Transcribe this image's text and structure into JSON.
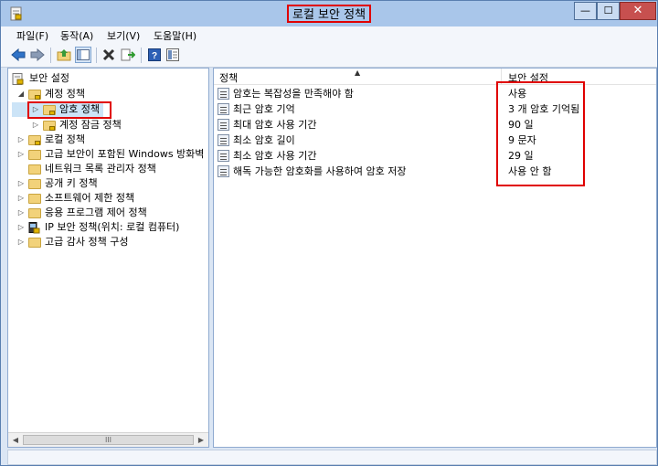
{
  "window": {
    "title": "로컬 보안 정책",
    "minimize_glyph": "—",
    "maximize_glyph": "☐",
    "close_glyph": "✕"
  },
  "menu": [
    "파일(F)",
    "동작(A)",
    "보기(V)",
    "도움말(H)"
  ],
  "toolbar_icons": [
    "back-arrow-icon",
    "forward-arrow-icon",
    "up-folder-icon",
    "show-hide-tree-icon",
    "delete-icon",
    "export-list-icon",
    "help-icon",
    "properties-icon"
  ],
  "tree": {
    "root": "보안 설정",
    "account_policies": "계정 정책",
    "password_policy": "암호 정책",
    "lockout_policy": "계정 잠금 정책",
    "local_policies": "로컬 정책",
    "firewall": "고급 보안이 포함된 Windows 방화벽",
    "network_list": "네트워크 목록 관리자 정책",
    "public_key": "공개 키 정책",
    "software_restriction": "소프트웨어 제한 정책",
    "app_control": "응용 프로그램 제어 정책",
    "ip_security": "IP 보안 정책(위치: 로컬 컴퓨터)",
    "advanced_audit": "고급 감사 정책 구성"
  },
  "scrollbar": {
    "thumb_glyph": "III",
    "left_glyph": "◀",
    "right_glyph": "▶"
  },
  "list": {
    "col_policy": "정책",
    "col_setting": "보안 설정",
    "sort_glyph": "▲",
    "rows": [
      {
        "policy": "암호는 복잡성을 만족해야 함",
        "setting": "사용"
      },
      {
        "policy": "최근 암호 기억",
        "setting": "3 개 암호 기억됨"
      },
      {
        "policy": "최대 암호 사용 기간",
        "setting": "90 일"
      },
      {
        "policy": "최소 암호 길이",
        "setting": "9 문자"
      },
      {
        "policy": "최소 암호 사용 기간",
        "setting": "29 일"
      },
      {
        "policy": "해독 가능한 암호화를 사용하여 암호 저장",
        "setting": "사용 안 함"
      }
    ]
  },
  "colors": {
    "highlight_red": "#e00000",
    "title_bar": "#a9c6ea",
    "window_bg": "#dbe6f4"
  }
}
